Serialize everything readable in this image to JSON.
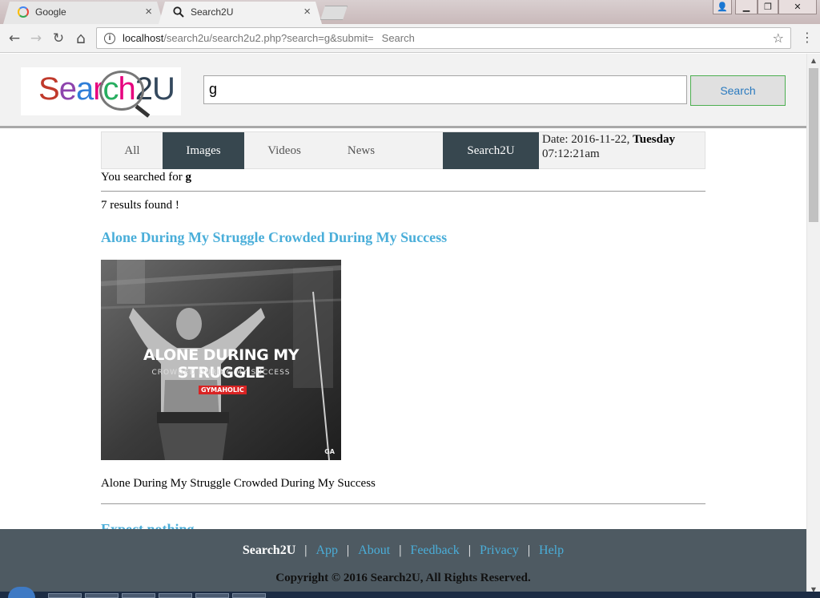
{
  "browser": {
    "tabs": [
      {
        "title": "Google",
        "icon": "google-g-icon",
        "active": false
      },
      {
        "title": "Search2U",
        "icon": "search-icon",
        "active": true
      }
    ],
    "url_host": "localhost",
    "url_path": "/search2u/search2u2.php?search=g&submit=",
    "url_extra": "Search",
    "glyphs": {
      "close": "×",
      "back": "←",
      "forward": "→",
      "reload": "↻",
      "home": "⌂",
      "info": "i",
      "star": "☆",
      "menu": "⋮",
      "minimize": "▁",
      "restore": "❐",
      "win_close": "✕",
      "user": "👤",
      "scroll_up": "▲",
      "scroll_down": "▼"
    }
  },
  "header": {
    "logo_text": "Search2U",
    "search_value": "g",
    "search_button": "Search"
  },
  "nav": {
    "items": [
      "All",
      "Images",
      "Videos",
      "News"
    ],
    "brand": "Search2U",
    "date_label": "Date: 2016-11-22,",
    "day": "Tuesday",
    "time": "07:12:21am"
  },
  "results": {
    "searched_prefix": "You searched for",
    "query": "g",
    "count_text": "7 results found !",
    "items": [
      {
        "title": "Alone During My Struggle Crowded During My Success",
        "description": "Alone During My Struggle Crowded During My Success",
        "image_text_main": "ALONE DURING MY STRUGGLE",
        "image_text_sub": "CROWDED DURING MY SUCCESS",
        "image_badge": "GYMAHOLIC",
        "image_corner": "GA"
      },
      {
        "title": "Expect nothing"
      }
    ]
  },
  "footer": {
    "brand": "Search2U",
    "separator": "|",
    "links": [
      "App",
      "About",
      "Feedback",
      "Privacy",
      "Help"
    ],
    "copyright": "Copyright © 2016 Search2U, All Rights Reserved."
  }
}
